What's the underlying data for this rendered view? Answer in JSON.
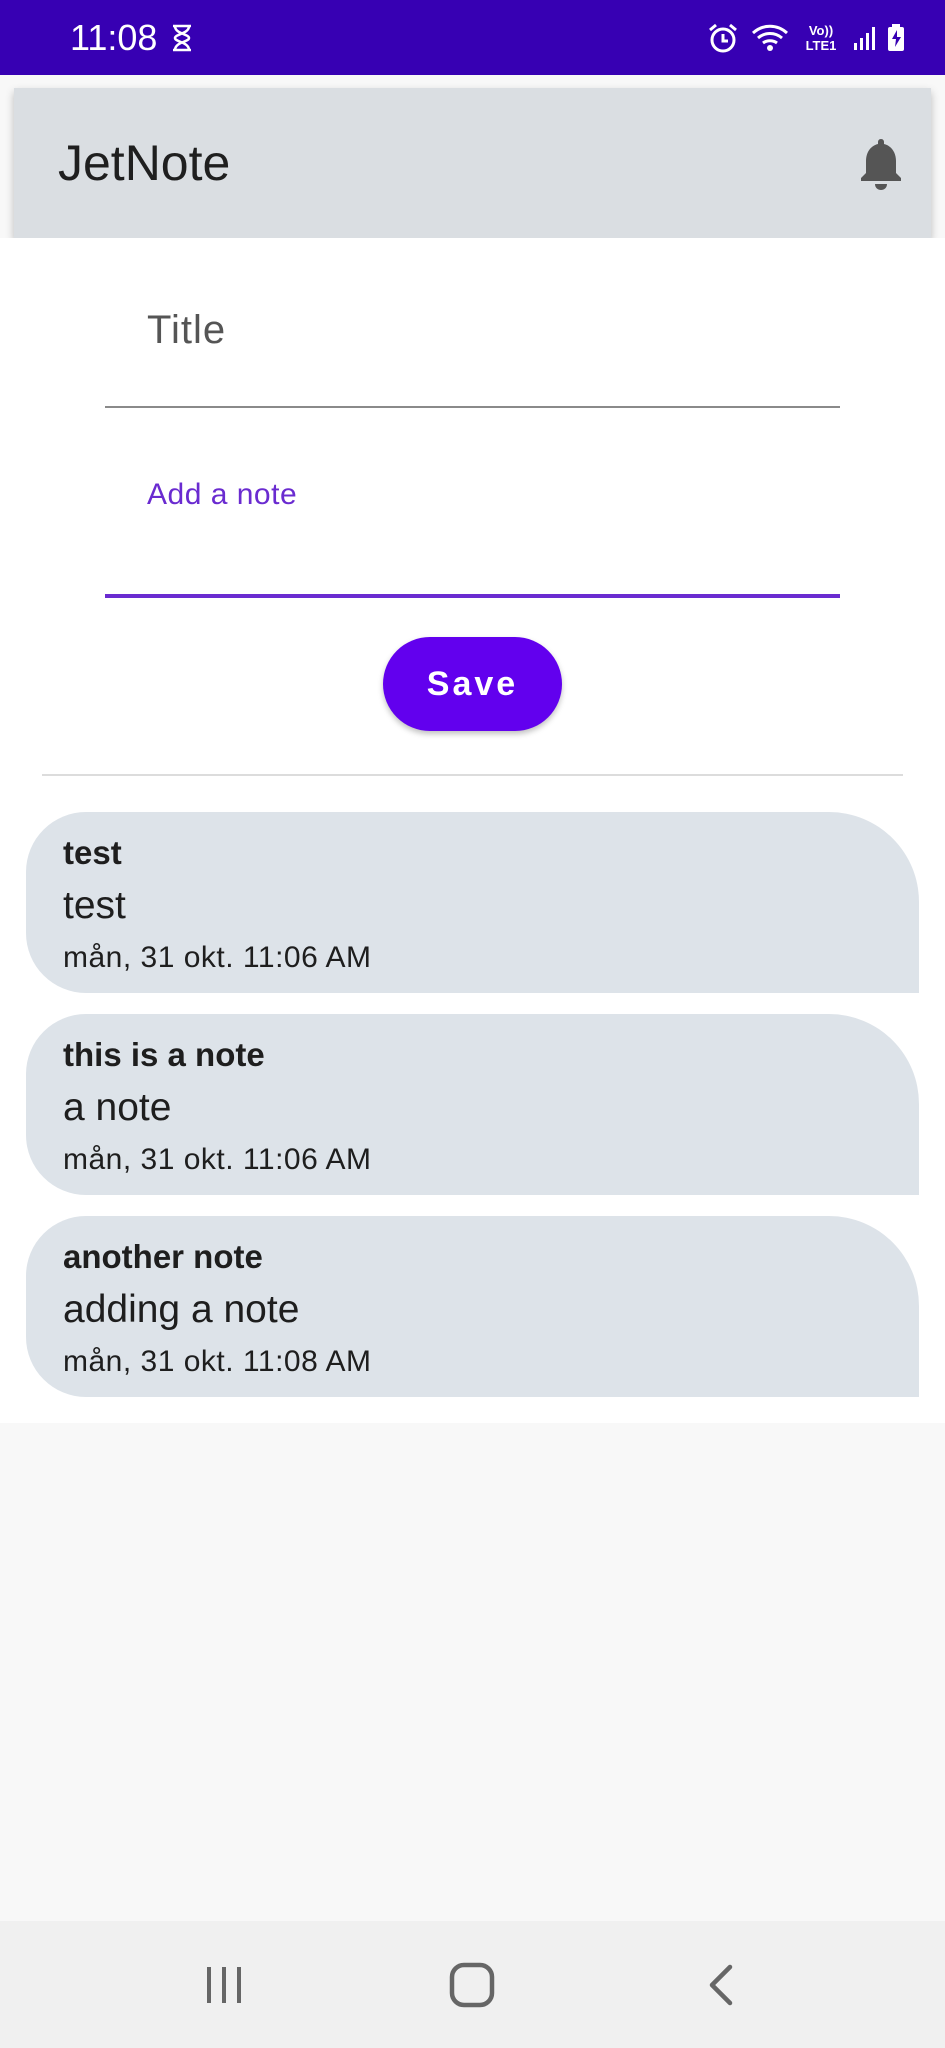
{
  "status_bar": {
    "time": "11:08",
    "icons": [
      "hourglass-icon",
      "alarm-icon",
      "wifi-icon",
      "volte-lte-icon",
      "signal-icon",
      "battery-charging-icon"
    ],
    "volte_text": "Vo)) LTE1"
  },
  "app_bar": {
    "title": "JetNote",
    "action_icon": "bell-icon"
  },
  "form": {
    "title_placeholder": "Title",
    "note_label": "Add a note",
    "save_label": "Save"
  },
  "notes": [
    {
      "title": "test",
      "text": "test",
      "date": "mån, 31 okt. 11:06 AM"
    },
    {
      "title": "this is a note",
      "text": "a note",
      "date": "mån, 31 okt. 11:06 AM"
    },
    {
      "title": "another note",
      "text": "adding a note",
      "date": "mån, 31 okt. 11:08 AM"
    }
  ],
  "nav_bar": {
    "buttons": [
      "recents-icon",
      "home-icon",
      "back-icon"
    ]
  },
  "colors": {
    "status_bar": "#3700b3",
    "primary": "#6200ee",
    "accent_field": "#6a2bd0",
    "app_bar": "#dadee2",
    "note_card": "#dde3e9"
  }
}
